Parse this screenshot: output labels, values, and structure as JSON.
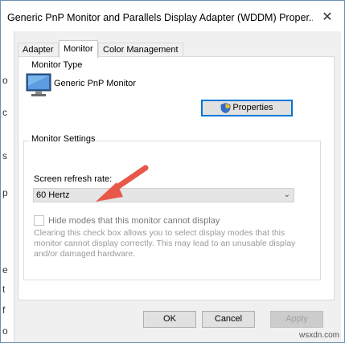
{
  "window": {
    "title": "Generic PnP Monitor and Parallels Display Adapter (WDDM) Proper...",
    "close_glyph": "✕"
  },
  "background_fragments": [
    "o",
    "c",
    "s",
    "p",
    "e",
    "t",
    "f",
    "o"
  ],
  "tabs": [
    {
      "label": "Adapter",
      "active": false
    },
    {
      "label": "Monitor",
      "active": true
    },
    {
      "label": "Color Management",
      "active": false
    }
  ],
  "monitor_type": {
    "group_label": "Monitor Type",
    "monitor_name": "Generic PnP Monitor",
    "properties_label": "Properties",
    "icon": "monitor-icon"
  },
  "monitor_settings": {
    "group_label": "Monitor Settings",
    "refresh_label": "Screen refresh rate:",
    "refresh_value": "60 Hertz",
    "hide_modes_label": "Hide modes that this monitor cannot display",
    "hide_modes_checked": false,
    "help_text": "Clearing this check box allows you to select display modes that this monitor cannot display correctly. This may lead to an unusable display and/or damaged hardware."
  },
  "buttons": {
    "ok": "OK",
    "cancel": "Cancel",
    "apply": "Apply"
  },
  "watermark": "wsxdn.com",
  "colors": {
    "accent": "#0078d7",
    "arrow": "#e8584a"
  }
}
